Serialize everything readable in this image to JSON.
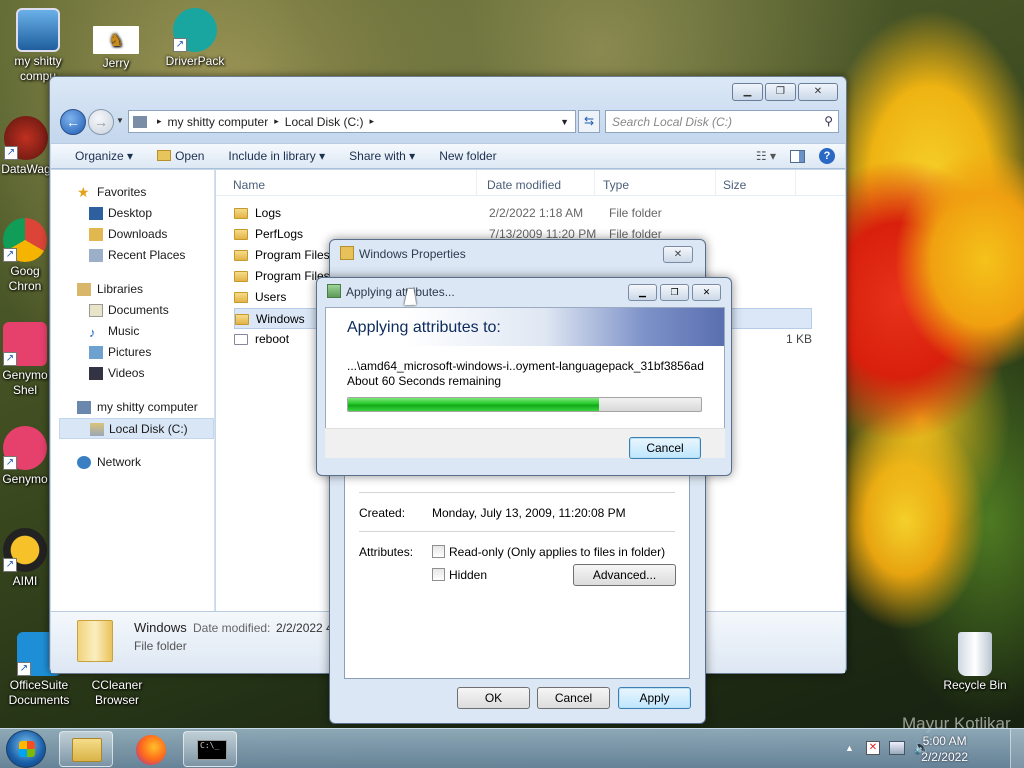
{
  "desktop": {
    "icons": [
      {
        "label": "my shitty compu",
        "icon": "computer-icon"
      },
      {
        "label": "Jerry",
        "icon": "jerry-image-icon"
      },
      {
        "label": "DriverPack",
        "icon": "driverpack-icon"
      },
      {
        "label": "DataWag",
        "icon": "datawag-icon"
      },
      {
        "label": "Goog Chron",
        "icon": "chrome-icon"
      },
      {
        "label": "Genymo Shel",
        "icon": "genymotion-shell-icon"
      },
      {
        "label": "Genymo",
        "icon": "genymotion-icon"
      },
      {
        "label": "AIMI",
        "icon": "aimp-icon"
      },
      {
        "label": "OfficeSuite Documents",
        "icon": "officesuite-icon"
      },
      {
        "label": "CCleaner Browser",
        "icon": "ccleaner-icon"
      },
      {
        "label": "Recycle Bin",
        "icon": "recycle-bin-icon"
      }
    ],
    "watermark": "Mayur Kotlikar"
  },
  "explorer": {
    "address": {
      "segments": [
        "my shitty computer",
        "Local Disk (C:)"
      ]
    },
    "search_placeholder": "Search Local Disk (C:)",
    "toolbar": {
      "organize": "Organize ▾",
      "open": "Open",
      "include": "Include in library ▾",
      "share": "Share with ▾",
      "new_folder": "New folder"
    },
    "nav": {
      "favorites": "Favorites",
      "desktop": "Desktop",
      "downloads": "Downloads",
      "recent": "Recent Places",
      "libraries": "Libraries",
      "documents": "Documents",
      "music": "Music",
      "pictures": "Pictures",
      "videos": "Videos",
      "computer": "my shitty computer",
      "localdisk": "Local Disk (C:)",
      "network": "Network"
    },
    "columns": {
      "name": "Name",
      "date": "Date modified",
      "type": "Type",
      "size": "Size"
    },
    "files": [
      {
        "name": "Logs",
        "date": "2/2/2022 1:18 AM",
        "type": "File folder",
        "size": ""
      },
      {
        "name": "PerfLogs",
        "date": "7/13/2009 11:20 PM",
        "type": "File folder",
        "size": ""
      },
      {
        "name": "Program Files",
        "date": "",
        "type": "",
        "size": ""
      },
      {
        "name": "Program Files",
        "date": "",
        "type": "",
        "size": ""
      },
      {
        "name": "Users",
        "date": "",
        "type": "",
        "size": ""
      },
      {
        "name": "Windows",
        "date": "",
        "type": "",
        "size": ""
      },
      {
        "name": "reboot",
        "date": "",
        "type": "",
        "size": "1 KB"
      }
    ],
    "details": {
      "name": "Windows",
      "date_label": "Date modified:",
      "date_value": "2/2/2022 4",
      "type": "File folder"
    }
  },
  "properties": {
    "title": "Windows Properties",
    "created_label": "Created:",
    "created_value": "Monday, July 13, 2009, 11:20:08 PM",
    "attributes_label": "Attributes:",
    "readonly": "Read-only (Only applies to files in folder)",
    "hidden": "Hidden",
    "advanced": "Advanced...",
    "ok": "OK",
    "cancel": "Cancel",
    "apply": "Apply"
  },
  "applying": {
    "title": "Applying attributes...",
    "heading": "Applying attributes to:",
    "path": "...\\amd64_microsoft-windows-i..oyment-languagepack_31bf3856ad",
    "remaining": "About 60 Seconds remaining",
    "progress": 0.71,
    "cancel": "Cancel"
  },
  "taskbar": {
    "time": "5:00 AM",
    "date": "2/2/2022"
  }
}
